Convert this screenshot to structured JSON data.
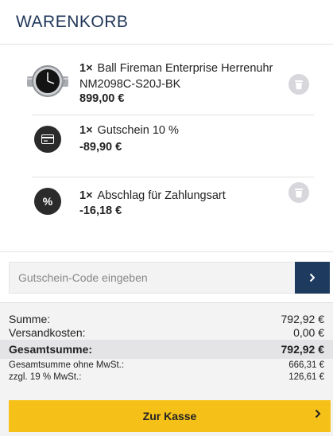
{
  "header": {
    "title": "WARENKORB"
  },
  "cart": {
    "items": [
      {
        "qty": "1×",
        "name": "Ball Fireman Enterprise Herrenuhr NM2098C-S20J-BK",
        "price": "899,00 €",
        "icon": "watch-thumbnail"
      },
      {
        "qty": "1×",
        "name": "Gutschein 10 %",
        "price": "-89,90 €",
        "icon": "voucher-icon"
      },
      {
        "qty": "1×",
        "name": "Abschlag für Zahlungsart",
        "price": "-16,18 €",
        "icon": "percent-icon",
        "icon_text": "%"
      }
    ]
  },
  "coupon": {
    "placeholder": "Gutschein-Code eingeben",
    "button_icon": "chevron-right-icon"
  },
  "summary": {
    "subtotal_label": "Summe:",
    "subtotal_value": "792,92 €",
    "shipping_label": "Versandkosten:",
    "shipping_value": "0,00 €",
    "total_label": "Gesamtsumme:",
    "total_value": "792,92 €",
    "net_label": "Gesamtsumme ohne MwSt.:",
    "net_value": "666,31 €",
    "tax_label": "zzgl. 19 % MwSt.:",
    "tax_value": "126,61 €"
  },
  "checkout": {
    "label": "Zur Kasse"
  },
  "colors": {
    "accent": "#f5c119",
    "brand_dark": "#1f3a5f",
    "title": "#1f3557"
  }
}
